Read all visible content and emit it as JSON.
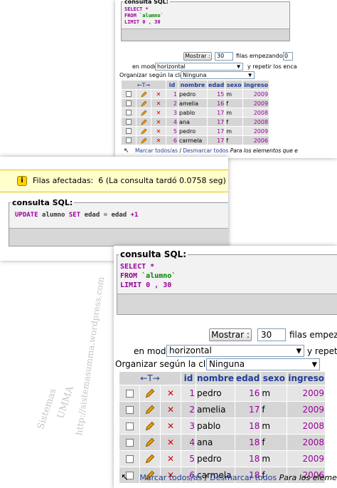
{
  "sql_legend": "consulta SQL:",
  "select_query": {
    "select": "SELECT",
    "star": "*",
    "from": "FROM",
    "table": "`alumno`",
    "limit": "LIMIT",
    "limit_values": "0 , 30"
  },
  "update_query": {
    "update": "UPDATE",
    "table": "alumno",
    "set": "SET",
    "col": "edad",
    "eq": "=",
    "col2": "edad",
    "plus": "+1"
  },
  "controls": {
    "show_button": "Mostrar :",
    "rows_value": "30",
    "rows_label_small": "filas empezando de",
    "rows_label_big": "filas empeza",
    "start_value_small": "0",
    "mode_label": "en modo",
    "mode_value": "horizontal",
    "repeat_label_small": "y repetir los enca",
    "repeat_label_big": "y repetir",
    "sort_label": "Organizar según la clave:",
    "sort_value": "Ninguna"
  },
  "alert": {
    "icon": "i",
    "label": "Filas afectadas:",
    "count": "6",
    "message": "(La consulta tardó 0.0758 seg)"
  },
  "columns": [
    "id",
    "nombre",
    "edad",
    "sexo",
    "ingreso"
  ],
  "rows_before": [
    {
      "id": "1",
      "nombre": "pedro",
      "edad": "15",
      "sexo": "m",
      "ingreso": "2009"
    },
    {
      "id": "2",
      "nombre": "amelia",
      "edad": "16",
      "sexo": "f",
      "ingreso": "2009"
    },
    {
      "id": "3",
      "nombre": "pablo",
      "edad": "17",
      "sexo": "m",
      "ingreso": "2008"
    },
    {
      "id": "4",
      "nombre": "ana",
      "edad": "17",
      "sexo": "f",
      "ingreso": "2008"
    },
    {
      "id": "5",
      "nombre": "pedro",
      "edad": "17",
      "sexo": "m",
      "ingreso": "2009"
    },
    {
      "id": "6",
      "nombre": "carmela",
      "edad": "17",
      "sexo": "f",
      "ingreso": "2006"
    }
  ],
  "rows_after": [
    {
      "id": "1",
      "nombre": "pedro",
      "edad": "16",
      "sexo": "m",
      "ingreso": "2009"
    },
    {
      "id": "2",
      "nombre": "amelia",
      "edad": "17",
      "sexo": "f",
      "ingreso": "2009"
    },
    {
      "id": "3",
      "nombre": "pablo",
      "edad": "18",
      "sexo": "m",
      "ingreso": "2008"
    },
    {
      "id": "4",
      "nombre": "ana",
      "edad": "18",
      "sexo": "f",
      "ingreso": "2008"
    },
    {
      "id": "5",
      "nombre": "pedro",
      "edad": "18",
      "sexo": "m",
      "ingreso": "2009"
    },
    {
      "id": "6",
      "nombre": "carmela",
      "edad": "18",
      "sexo": "f",
      "ingreso": "2006"
    }
  ],
  "footer": {
    "mark_all": "Marcar todos/as",
    "separator": "/",
    "unmark_all": "Desmarcar todos",
    "small_suffix": "Para los elementos que e",
    "big_suffix": "Para los element"
  },
  "watermark": {
    "line1": "Sistemas",
    "line2": "UMMA",
    "url": "http://sistemasumma.wordpress.com"
  },
  "colors": {
    "keyword": "#990099",
    "string": "#008000",
    "header_text": "#1f3c99",
    "alert_bg": "#ffffcc",
    "delete_icon": "#d40000"
  }
}
